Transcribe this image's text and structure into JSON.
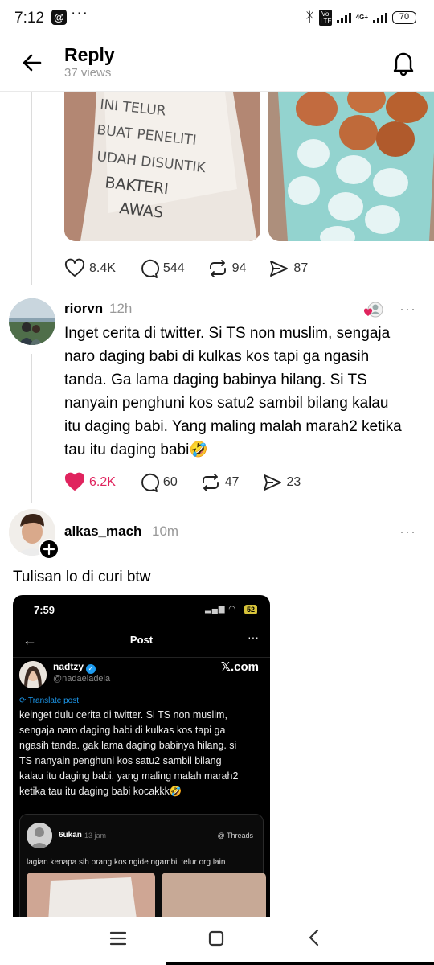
{
  "status_bar": {
    "time": "7:12",
    "app_icon": "@",
    "more": "···",
    "lte": "Vo LTE",
    "network": "4G+",
    "battery": "70"
  },
  "header": {
    "title": "Reply",
    "views": "37 views"
  },
  "op_post": {
    "photo_text": [
      "INI TELUR",
      "BUAT PENELITI",
      "UDAH DISUNTIK",
      "BAKTERI",
      "AWAS"
    ],
    "likes": "8.4K",
    "comments": "544",
    "reposts": "94",
    "shares": "87"
  },
  "reply1": {
    "username": "riorvn",
    "timestamp": "12h",
    "lines": [
      "Inget cerita di twitter. Si TS non muslim, sengaja",
      "naro daging babi di kulkas kos tapi ga ngasih",
      "tanda. Ga lama daging babinya hilang. Si TS",
      "nanyain penghuni kos satu2 sambil bilang kalau",
      "itu daging babi. Yang maling malah marah2 ketika",
      "tau itu daging babi🤣"
    ],
    "likes": "6.2K",
    "comments": "60",
    "reposts": "47",
    "shares": "23"
  },
  "reply2": {
    "username": "alkas_mach",
    "timestamp": "10m",
    "text": "Tulisan lo di curi btw",
    "screenshot": {
      "time": "7:59",
      "battery": "52",
      "title": "Post",
      "name": "nadtzy",
      "handle": "@nadaeladela",
      "brand": "𝕏.com",
      "translate": "Translate post",
      "lines": [
        "keinget dulu cerita di twitter. Si TS non muslim,",
        "sengaja naro daging babi di kulkas kos tapi ga",
        "ngasih tanda. gak lama daging babinya hilang. si",
        "TS nanyain penghuni kos satu2 sambil bilang",
        "kalau itu daging babi. yang maling malah marah2",
        "ketika tau itu daging babi kocakkk🤣"
      ],
      "quote": {
        "name": "6ukan",
        "time": "13 jam",
        "source": "Threads",
        "text": "lagian kenapa sih orang kos ngide ngambil telur org lain"
      }
    }
  },
  "colors": {
    "like": "#e0245e",
    "muted": "#999999",
    "link": "#1d9bf0"
  }
}
